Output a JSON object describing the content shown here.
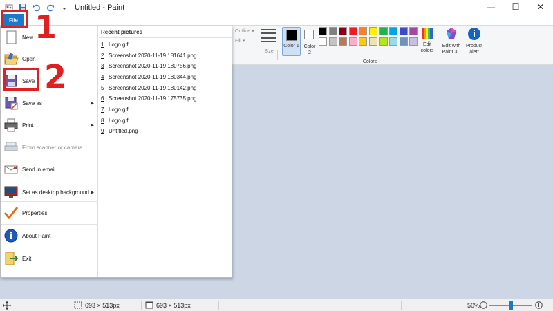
{
  "window": {
    "title": "Untitled - Paint",
    "minimize_glyph": "—",
    "maximize_glyph": "☐",
    "close_glyph": "✕"
  },
  "ribbon": {
    "outline_label": "Outline",
    "fill_label": "Fill",
    "size_label": "Size",
    "color1_label": "Color 1",
    "color2_label": "Color 2",
    "colors_group_label": "Colors",
    "edit_colors_label": "Edit colors",
    "edit_paint3d_label": "Edit with Paint 3D",
    "product_alert_label": "Product alert",
    "palette_row1": [
      "#000000",
      "#7f7f7f",
      "#880015",
      "#ed1c24",
      "#ff7f27",
      "#fff200",
      "#22b14c",
      "#00a2e8",
      "#3f48cc",
      "#a349a4"
    ],
    "palette_row2": [
      "#ffffff",
      "#c3c3c3",
      "#b97a57",
      "#ffaec9",
      "#ffc90e",
      "#efe4b0",
      "#b5e61d",
      "#99d9ea",
      "#7092be",
      "#c8bfe7"
    ]
  },
  "file_menu": {
    "tab_label": "File",
    "items": [
      {
        "label": "New",
        "icon": "new-file-icon"
      },
      {
        "label": "Open",
        "icon": "open-folder-icon"
      },
      {
        "label": "Save",
        "icon": "save-floppy-icon"
      },
      {
        "label": "Save as",
        "icon": "save-as-icon",
        "arrow": "▶"
      },
      {
        "label": "Print",
        "icon": "printer-icon",
        "arrow": "▶"
      },
      {
        "label": "From scanner or camera",
        "icon": "scanner-icon",
        "disabled": true
      },
      {
        "label": "Send in email",
        "icon": "email-icon"
      },
      {
        "label": "Set as desktop background",
        "icon": "desktop-icon",
        "arrow": "▶"
      },
      {
        "label": "Properties",
        "icon": "checkmark-icon"
      },
      {
        "label": "About Paint",
        "icon": "info-icon"
      },
      {
        "label": "Exit",
        "icon": "exit-icon"
      }
    ],
    "recent_title": "Recent pictures",
    "recent": [
      {
        "num": "1",
        "name": "Logo.gif"
      },
      {
        "num": "2",
        "name": "Screenshot 2020-11-19 181641.png"
      },
      {
        "num": "3",
        "name": "Screenshot 2020-11-19 180756.png"
      },
      {
        "num": "4",
        "name": "Screenshot 2020-11-19 180344.png"
      },
      {
        "num": "5",
        "name": "Screenshot 2020-11-19 180142.png"
      },
      {
        "num": "6",
        "name": "Screenshot 2020-11-19 175735.png"
      },
      {
        "num": "7",
        "name": "Logo.gif"
      },
      {
        "num": "8",
        "name": "Logo.gif"
      },
      {
        "num": "9",
        "name": "Untitled.png"
      }
    ]
  },
  "statusbar": {
    "selection_size": "693 × 513px",
    "canvas_size": "693 × 513px",
    "zoom": "50%",
    "zoom_slider_fraction": 0.5
  },
  "annotations": {
    "step1": "1",
    "step2": "2"
  },
  "colors": {
    "accent": "#1979ca",
    "annotation": "#e02020",
    "canvas_bg": "#ccd6e5"
  }
}
